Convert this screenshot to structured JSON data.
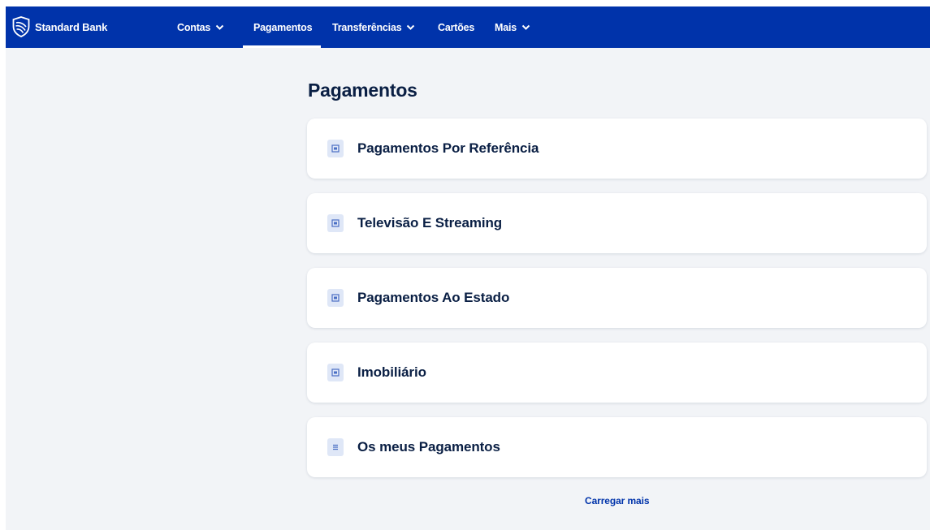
{
  "brand": {
    "name": "Standard Bank",
    "logo_icon": "shield-logo-icon",
    "color": "#0033aa"
  },
  "nav": {
    "items": [
      {
        "label": "Contas",
        "has_dropdown": true,
        "active": false
      },
      {
        "label": "Pagamentos",
        "has_dropdown": false,
        "active": true
      },
      {
        "label": "Transferências",
        "has_dropdown": true,
        "active": false
      },
      {
        "label": "Cartões",
        "has_dropdown": false,
        "active": false
      },
      {
        "label": "Mais",
        "has_dropdown": true,
        "active": false
      }
    ]
  },
  "main": {
    "title": "Pagamentos",
    "cards": [
      {
        "label": "Pagamentos Por Referência",
        "icon": "document-icon"
      },
      {
        "label": "Televisão E Streaming",
        "icon": "document-icon"
      },
      {
        "label": "Pagamentos Ao Estado",
        "icon": "document-icon"
      },
      {
        "label": "Imobiliário",
        "icon": "document-icon"
      },
      {
        "label": "Os meus Pagamentos",
        "icon": "list-icon"
      }
    ],
    "load_more_label": "Carregar mais"
  },
  "colors": {
    "nav_background": "#0033aa",
    "page_background": "#f2f4f7",
    "title_text": "#0a1f44",
    "link": "#0033aa",
    "icon_tile": "#dfe7f7"
  }
}
